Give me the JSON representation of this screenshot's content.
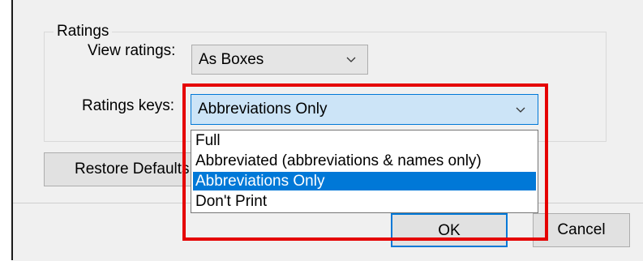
{
  "group": {
    "title": "Ratings"
  },
  "view_ratings": {
    "label": "View ratings:",
    "value": "As Boxes"
  },
  "ratings_keys": {
    "label": "Ratings keys:",
    "value": "Abbreviations Only",
    "options": [
      "Full",
      "Abbreviated (abbreviations & names only)",
      "Abbreviations Only",
      "Don't Print"
    ],
    "selected_index": 2
  },
  "buttons": {
    "restore_defaults": "Restore Defaults",
    "ok": "OK",
    "cancel": "Cancel"
  },
  "colors": {
    "highlight": "#e50000",
    "selection": "#0078d7",
    "focus_fill": "#cce4f7"
  },
  "icons": {
    "combo_arrow": "chevron-down-icon"
  }
}
